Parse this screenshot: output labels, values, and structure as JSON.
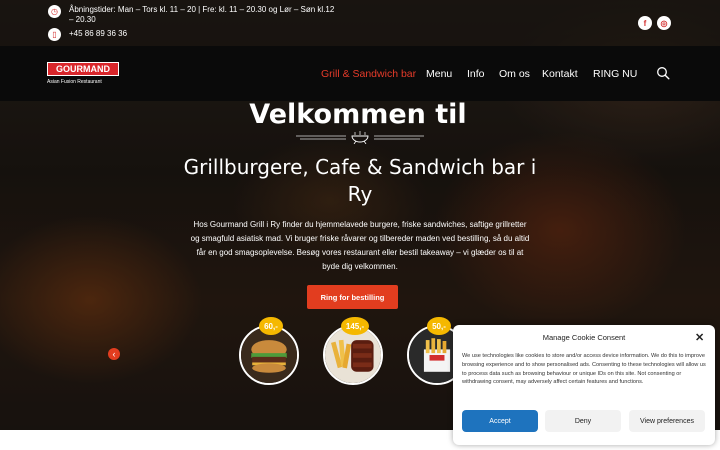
{
  "topbar": {
    "hours": "Åbningstider: Man – Tors kl. 11 – 20 | Fre: kl. 11 – 20.30 og Lør – Søn kl.12 – 20.30",
    "phone": "+45 86 89 36 36",
    "hours_icon": "clock-icon",
    "phone_icon": "phone-icon",
    "social": [
      {
        "name": "facebook-icon",
        "glyph": "f"
      },
      {
        "name": "instagram-icon",
        "glyph": "◎"
      }
    ]
  },
  "logo": {
    "name": "GOURMAND",
    "tagline": "Asian Fusion Restaurant"
  },
  "nav": {
    "items": [
      {
        "label": "Grill & Sandwich bar",
        "active": true
      },
      {
        "label": "Menu"
      },
      {
        "label": "Info"
      },
      {
        "label": "Om os"
      },
      {
        "label": "Kontakt"
      },
      {
        "label": "RING NU"
      }
    ]
  },
  "hero": {
    "heading": "Velkommen til",
    "subheading": "Grillburgere, Cafe & Sandwich bar i Ry",
    "description": "Hos Gourmand Grill i Ry finder du hjemmelavede burgere, friske sandwiches, saftige grillretter og smagfuld asiatisk mad. Vi bruger friske råvarer og tilbereder maden ved bestilling, så du altid får en god smagsoplevelse. Besøg vores restaurant eller bestil takeaway – vi glæder os til at byde dig velkommen.",
    "cta": "Ring for bestilling"
  },
  "products": [
    {
      "price": "60,-",
      "icon": "burger"
    },
    {
      "price": "145,-",
      "icon": "ribs-fries"
    },
    {
      "price": "50,-",
      "icon": "fries-box"
    }
  ],
  "cookie": {
    "title": "Manage Cookie Consent",
    "text": "We use technologies like cookies to store and/or access device information. We do this to improve browsing experience and to show personalised ads. Consenting to these technologies will allow us to process data such as browsing behaviour or unique IDs on this site. Not consenting or withdrawing consent, may adversely affect certain features and functions.",
    "accept": "Accept",
    "deny": "Deny",
    "preferences": "View preferences",
    "accent": "#1e73be"
  },
  "colors": {
    "brand_red": "#e23d1f",
    "price_badge": "#f5b800"
  }
}
